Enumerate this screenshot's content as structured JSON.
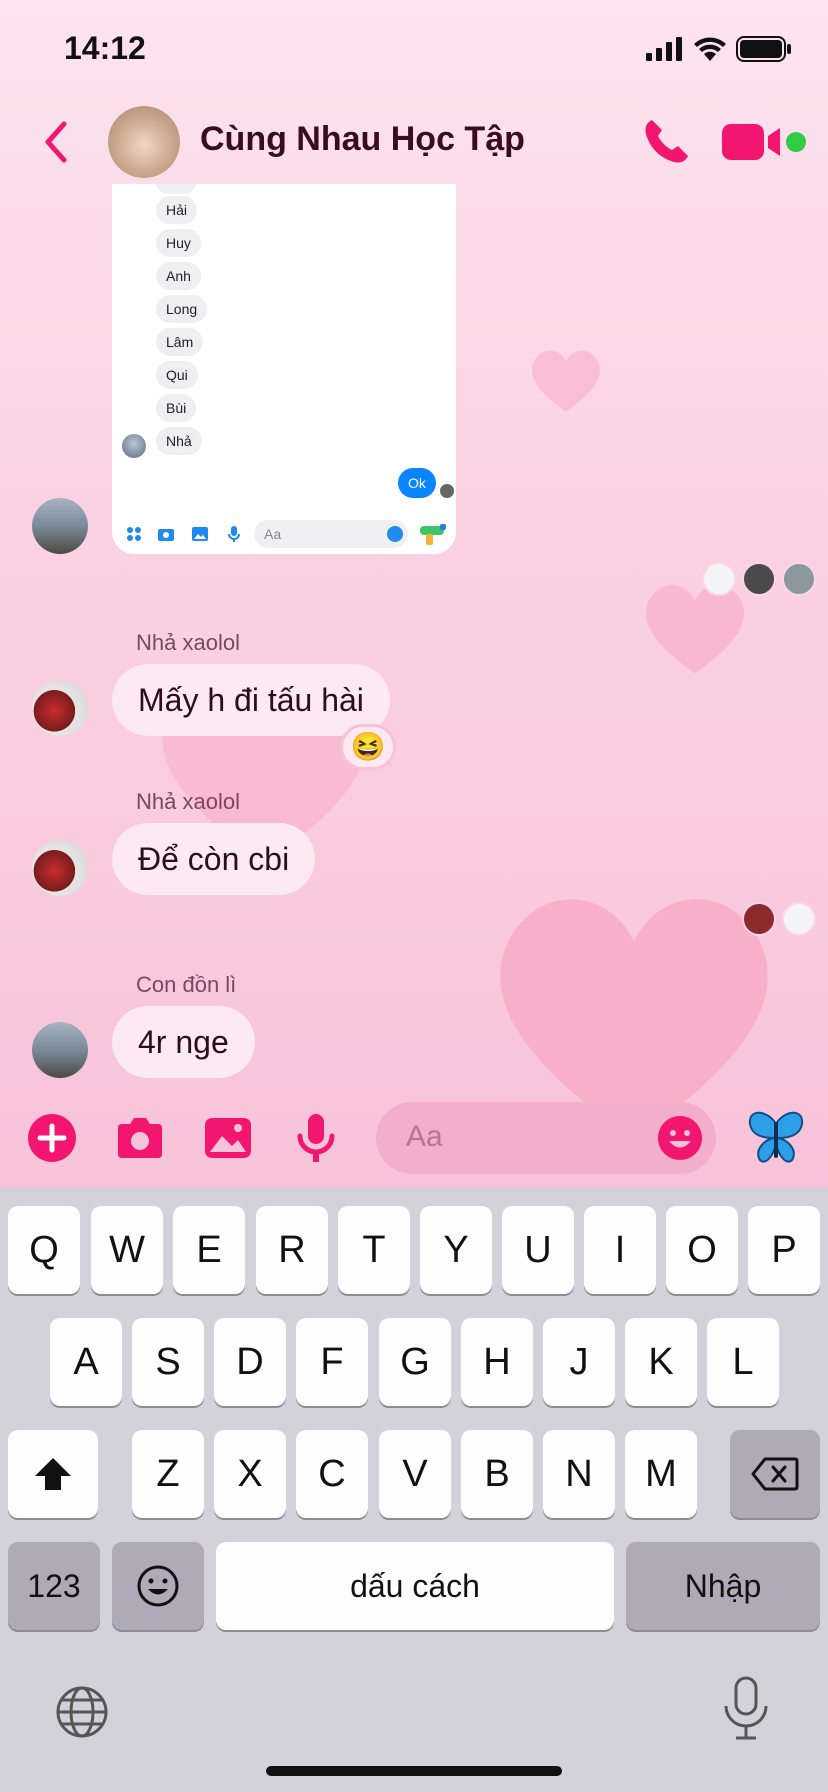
{
  "status_bar": {
    "time": "14:12"
  },
  "header": {
    "title": "Cùng Nhau Học Tập"
  },
  "shared_image": {
    "names": [
      "Hải",
      "Huy",
      "Anh",
      "Long",
      "Lâm",
      "Qui",
      "Bùi",
      "Nhả"
    ],
    "reply": "Ok",
    "input_placeholder": "Aa"
  },
  "messages": [
    {
      "sender": "Nhả xaolol",
      "text": "Mấy h đi tấu hài",
      "reaction": "😆"
    },
    {
      "sender": "Nhả xaolol",
      "text": "Để còn cbi"
    },
    {
      "sender": "Con đồn lì",
      "text": "4r nge"
    }
  ],
  "composer": {
    "placeholder": "Aa",
    "quick_reaction": "🦋"
  },
  "keyboard": {
    "row1": [
      "Q",
      "W",
      "E",
      "R",
      "T",
      "Y",
      "U",
      "I",
      "O",
      "P"
    ],
    "row2": [
      "A",
      "S",
      "D",
      "F",
      "G",
      "H",
      "J",
      "K",
      "L"
    ],
    "row3": [
      "Z",
      "X",
      "C",
      "V",
      "B",
      "N",
      "M"
    ],
    "numbers_key": "123",
    "space_label": "dấu cách",
    "return_label": "Nhập"
  },
  "colors": {
    "accent": "#f31670",
    "bubble": "#fde9f1",
    "online": "#31cc46"
  }
}
